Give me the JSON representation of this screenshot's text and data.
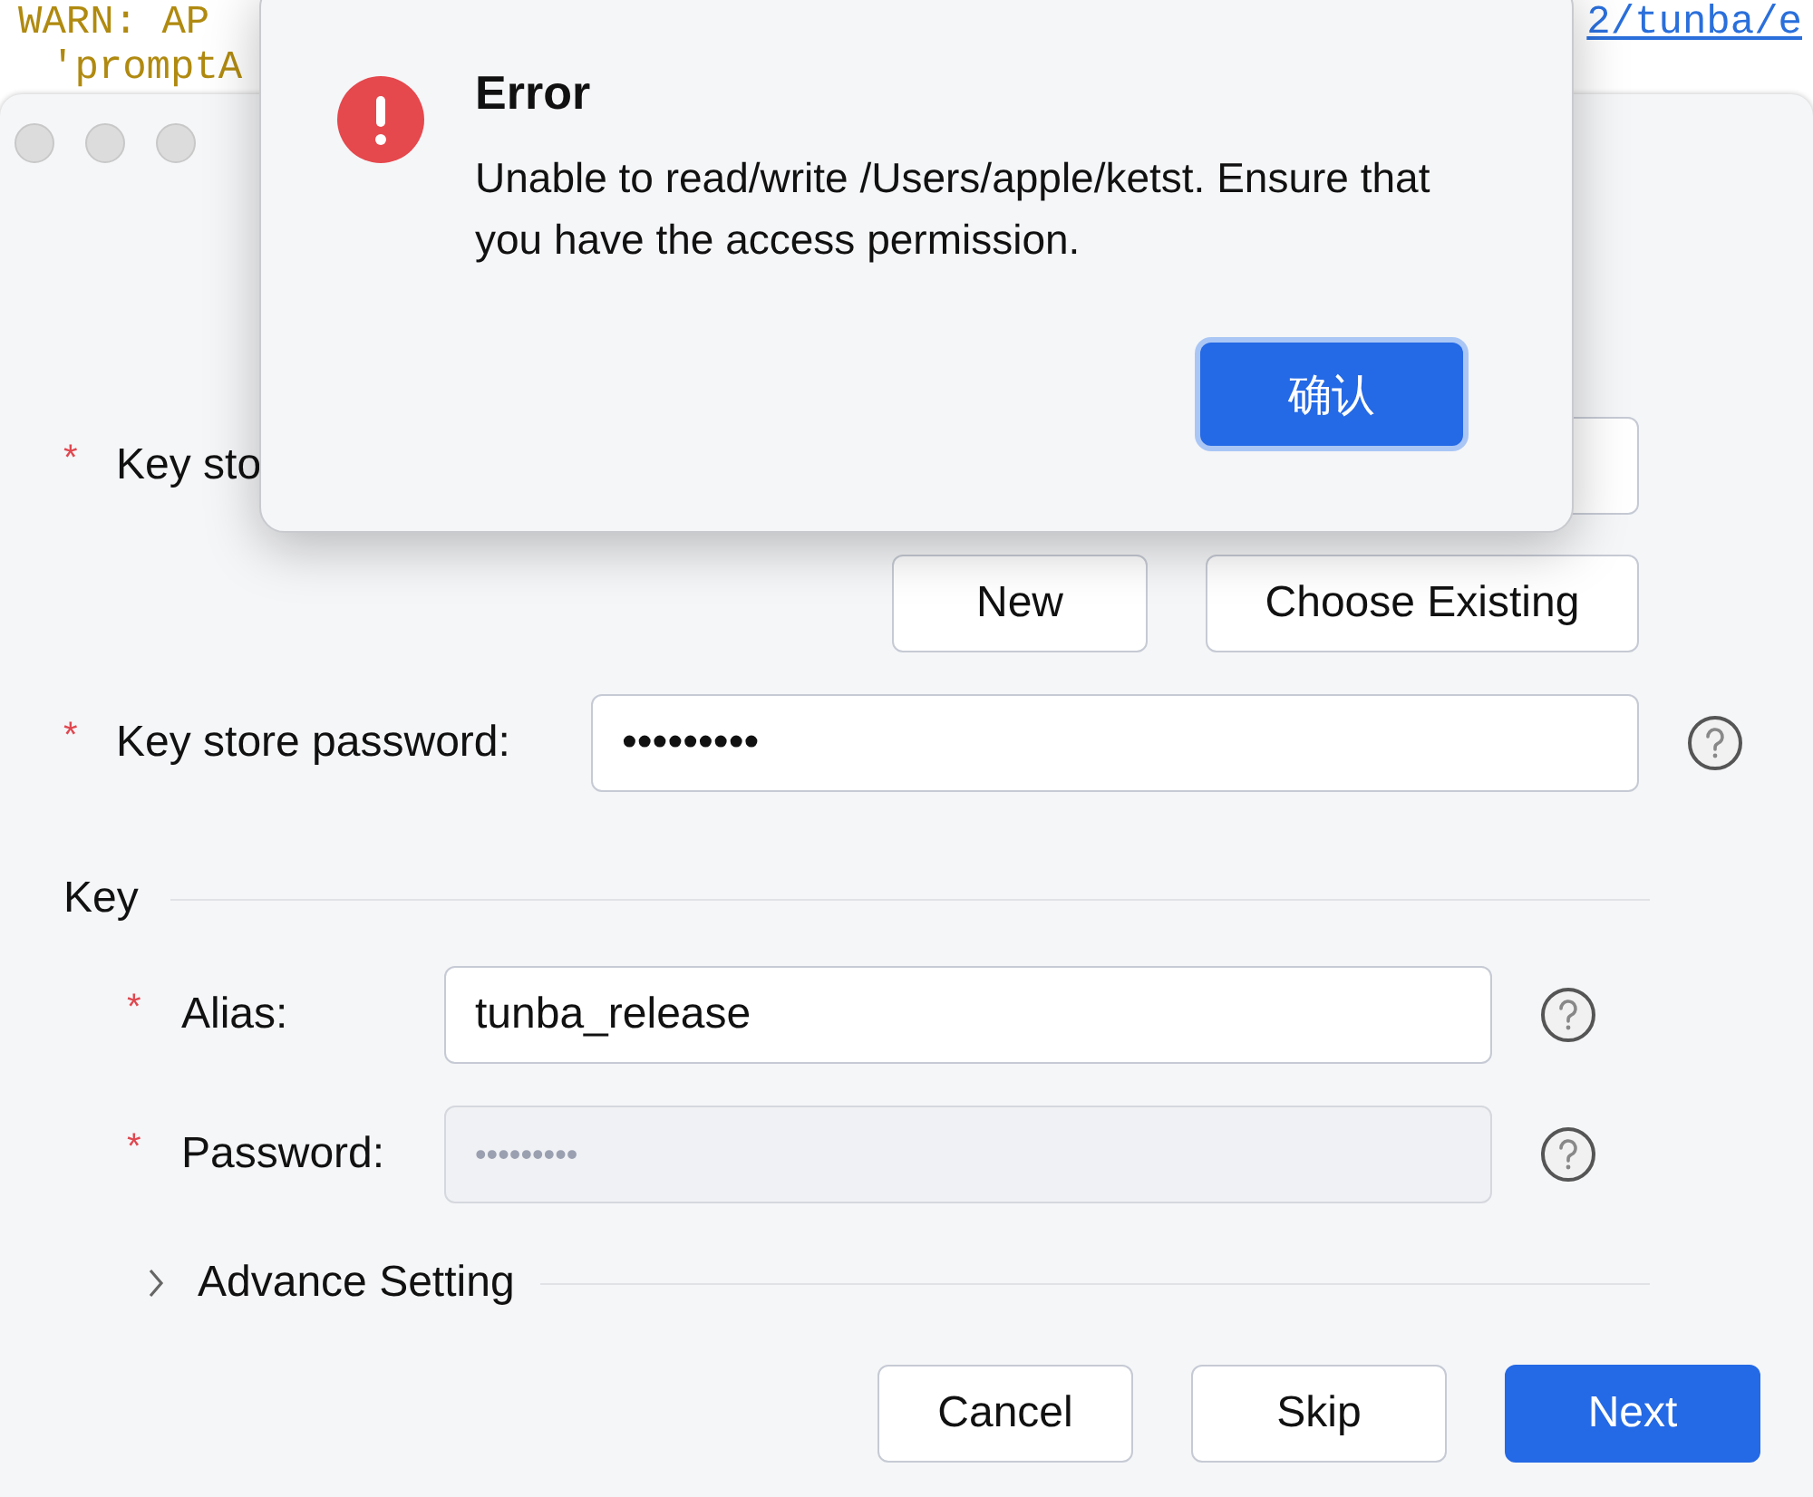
{
  "terminal": {
    "lines": [
      {
        "text": "WARN: AP",
        "link": "2/tunba/e"
      },
      {
        "text": "'promptA"
      }
    ]
  },
  "window": {
    "form": {
      "rows": [
        {
          "kind": "field",
          "label": "Key sto",
          "required_mark": "*",
          "help": false,
          "disabled": false
        },
        {
          "kind": "buttons",
          "buttons": [
            "New",
            "Choose Existing"
          ]
        },
        {
          "kind": "field",
          "label": "Key store password:",
          "required_mark": "*",
          "value": "•••••••••",
          "help": true,
          "disabled": false
        }
      ],
      "key_section": {
        "title": "Key",
        "rows": [
          {
            "kind": "field",
            "label": "Alias:",
            "required_mark": "*",
            "value": "tunba_release",
            "help": true,
            "disabled": false
          },
          {
            "kind": "field",
            "label": "Password:",
            "required_mark": "*",
            "value": "•••••••••",
            "help": true,
            "disabled": true
          }
        ]
      },
      "advanced": {
        "label": "Advance Setting",
        "expanded": false
      }
    },
    "footer_buttons": [
      {
        "label": "Cancel",
        "primary": false
      },
      {
        "label": "Skip",
        "primary": false
      },
      {
        "label": "Next",
        "primary": true
      }
    ]
  },
  "alert": {
    "title": "Error",
    "message": "Unable to read/write /Users/apple/ketst. Ensure that you have the access permission.",
    "button": "确认"
  }
}
